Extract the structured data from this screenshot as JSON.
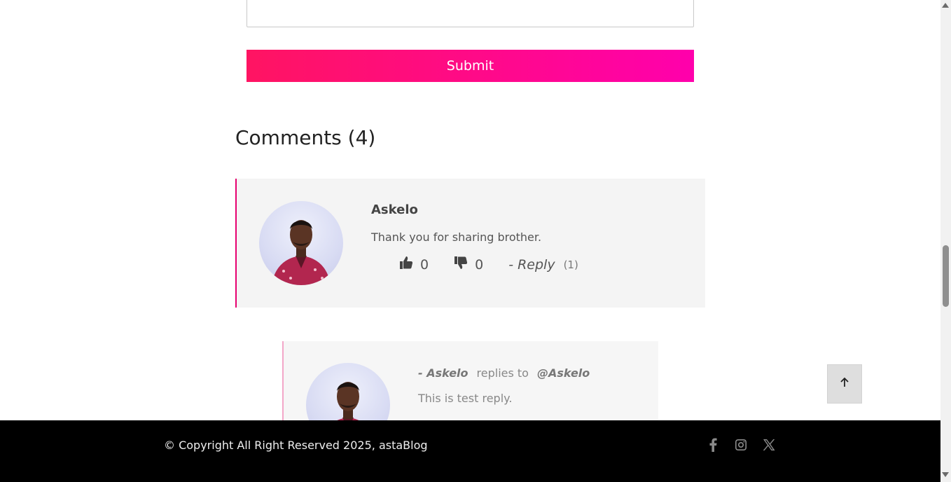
{
  "form": {
    "submit_label": "Submit"
  },
  "comments": {
    "title": "Comments (4)",
    "items": [
      {
        "author": "Askelo",
        "text": "Thank you for sharing brother.",
        "likes": "0",
        "dislikes": "0",
        "reply_label": "- Reply",
        "reply_count": "(1)"
      }
    ],
    "replies": [
      {
        "author": "- Askelo",
        "replies_to_label": "replies to",
        "target": "@Askelo",
        "text": "This is test reply."
      }
    ]
  },
  "footer": {
    "copyright": "© Copyright All Right Reserved 2025, astaBlog",
    "social_icons": [
      "facebook-icon",
      "instagram-icon",
      "x-icon"
    ]
  },
  "colors": {
    "accent_start": "#ff1462",
    "accent_end": "#ff00ac",
    "comment_border": "#e6006f",
    "footer_bg": "#000000"
  }
}
